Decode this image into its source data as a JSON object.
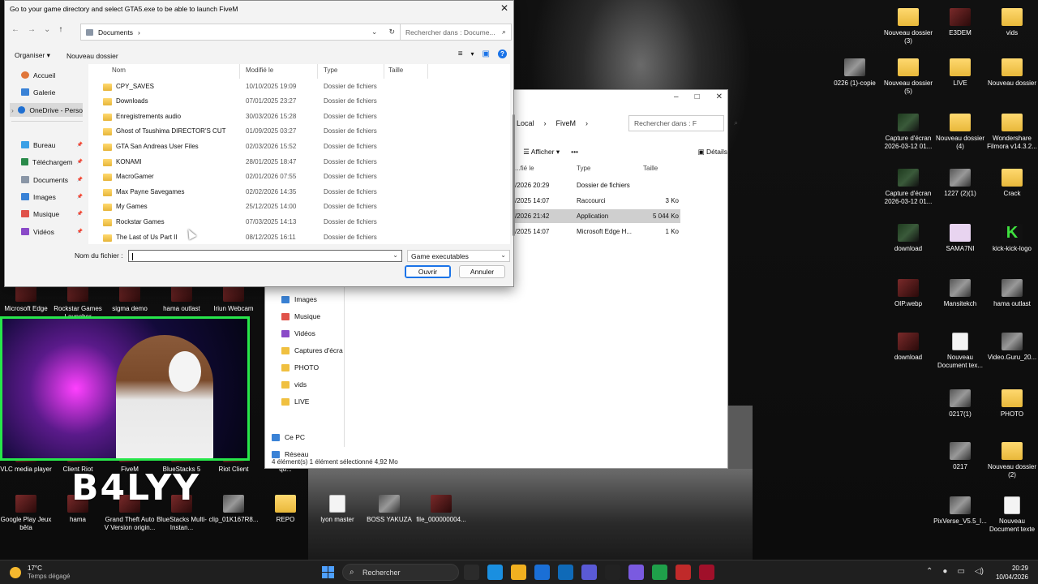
{
  "desktop": {
    "icons": [
      {
        "label": "Nouveau dossier (3)",
        "kind": "folder"
      },
      {
        "label": "E3DEM",
        "kind": "app"
      },
      {
        "label": "vids",
        "kind": "folder"
      },
      {
        "label": "0226 (1)-copie",
        "kind": "img"
      },
      {
        "label": "Nouveau dossier (5)",
        "kind": "folder"
      },
      {
        "label": "LIVE",
        "kind": "folder"
      },
      {
        "label": "Nouveau dossier",
        "kind": "folder"
      },
      {
        "label": "Capture d'écran 2026-03-12 01...",
        "kind": "dark"
      },
      {
        "label": "Nouveau dossier (4)",
        "kind": "folder"
      },
      {
        "label": "Wondershare Filmora v14.3.2...",
        "kind": "folder"
      },
      {
        "label": "Capture d'écran 2026-03-12 01...",
        "kind": "dark"
      },
      {
        "label": "1227 (2)(1)",
        "kind": "img"
      },
      {
        "label": "Crack",
        "kind": "folder"
      },
      {
        "label": "download",
        "kind": "dark"
      },
      {
        "label": "SAMA7NI",
        "kind": "pink"
      },
      {
        "label": "kick-kick-logo",
        "kind": "green"
      },
      {
        "label": "OIP.webp",
        "kind": "app"
      },
      {
        "label": "Mansitekch",
        "kind": "img"
      },
      {
        "label": "hama outlast",
        "kind": "img"
      },
      {
        "label": "download",
        "kind": "app"
      },
      {
        "label": "Nouveau Document tex...",
        "kind": "doc"
      },
      {
        "label": "Video.Guru_20...",
        "kind": "img"
      },
      {
        "label": "0217(1)",
        "kind": "img"
      },
      {
        "label": "PHOTO",
        "kind": "folder"
      },
      {
        "label": "0217",
        "kind": "img"
      },
      {
        "label": "Nouveau dossier (2)",
        "kind": "folder"
      },
      {
        "label": "PixVerse_V5.5_I...",
        "kind": "img"
      },
      {
        "label": "Nouveau Document texte",
        "kind": "doc"
      },
      {
        "label": "Microsoft Edge",
        "kind": "app"
      },
      {
        "label": "Rockstar Games Launcher",
        "kind": "app"
      },
      {
        "label": "sigma demo",
        "kind": "app"
      },
      {
        "label": "hama outlast",
        "kind": "app"
      },
      {
        "label": "Iriun Webcam",
        "kind": "app"
      },
      {
        "label": "VLC media player",
        "kind": "app"
      },
      {
        "label": "Client Riot",
        "kind": "app"
      },
      {
        "label": "FiveM",
        "kind": "app"
      },
      {
        "label": "BlueStacks 5",
        "kind": "app"
      },
      {
        "label": "Riot Client",
        "kind": "app"
      },
      {
        "label": "qu...",
        "kind": "app"
      },
      {
        "label": "Google Play Jeux bêta",
        "kind": "app"
      },
      {
        "label": "hama",
        "kind": "app"
      },
      {
        "label": "Grand Theft Auto V Version origin...",
        "kind": "app"
      },
      {
        "label": "BlueStacks Multi-Instan...",
        "kind": "app"
      },
      {
        "label": "clip_01K167R8...",
        "kind": "img"
      },
      {
        "label": "REPO",
        "kind": "folder"
      },
      {
        "label": "lyon master",
        "kind": "doc"
      },
      {
        "label": "BOSS YAKUZA",
        "kind": "img"
      },
      {
        "label": "file_000000004...",
        "kind": "app"
      }
    ],
    "overlay_text": "B4LYY"
  },
  "explorer": {
    "breadcrumb": [
      "Local",
      "FiveM"
    ],
    "search_placeholder": "Rechercher dans : F",
    "cmd": {
      "view": "Afficher",
      "more": "•••",
      "details": "Détails"
    },
    "columns": [
      "...fié le",
      "Type",
      "Taille"
    ],
    "rows": [
      {
        "date": "/2026 20:29",
        "type": "Dossier de fichiers",
        "size": ""
      },
      {
        "date": "/2025 14:07",
        "type": "Raccourci",
        "size": "3 Ko"
      },
      {
        "date": "/2026 21:42",
        "type": "Application",
        "size": "5 044 Ko"
      },
      {
        "date": "/2025 14:07",
        "type": "Microsoft Edge H...",
        "size": "1 Ko"
      }
    ],
    "nav": [
      "Images",
      "Musique",
      "Vidéos",
      "Captures d'écra",
      "PHOTO",
      "vids",
      "LIVE",
      "Ce PC",
      "Réseau"
    ],
    "status": "4 élément(s)     1 élément sélectionné  4,92 Mo"
  },
  "dialog": {
    "title": "Go to your game directory and select GTA5.exe to be able to launch FiveM",
    "address": "Documents",
    "search_placeholder": "Rechercher dans : Docume...",
    "organize": "Organiser ▾",
    "new_folder": "Nouveau dossier",
    "nav": [
      {
        "label": "Accueil",
        "color": "#e0763a",
        "pin": false
      },
      {
        "label": "Galerie",
        "color": "#3a82d6",
        "pin": false
      },
      {
        "label": "OneDrive - Perso",
        "color": "#1f6fd1",
        "pin": false,
        "selected": true
      },
      {
        "label": "Bureau",
        "color": "#3aa0e6",
        "pin": true
      },
      {
        "label": "Téléchargem",
        "color": "#2a8a4a",
        "pin": true
      },
      {
        "label": "Documents",
        "color": "#8a96a6",
        "pin": true
      },
      {
        "label": "Images",
        "color": "#3a82d6",
        "pin": true
      },
      {
        "label": "Musique",
        "color": "#e0524a",
        "pin": true
      },
      {
        "label": "Vidéos",
        "color": "#8a4ac8",
        "pin": true
      }
    ],
    "columns": {
      "name": "Nom",
      "modified": "Modifié le",
      "type": "Type",
      "size": "Taille"
    },
    "files": [
      {
        "name": "CPY_SAVES",
        "modified": "10/10/2025 19:09",
        "type": "Dossier de fichiers"
      },
      {
        "name": "Downloads",
        "modified": "07/01/2025 23:27",
        "type": "Dossier de fichiers"
      },
      {
        "name": "Enregistrements audio",
        "modified": "30/03/2026 15:28",
        "type": "Dossier de fichiers"
      },
      {
        "name": "Ghost of Tsushima DIRECTOR'S CUT",
        "modified": "01/09/2025 03:27",
        "type": "Dossier de fichiers"
      },
      {
        "name": "GTA San Andreas User Files",
        "modified": "02/03/2026 15:52",
        "type": "Dossier de fichiers"
      },
      {
        "name": "KONAMI",
        "modified": "28/01/2025 18:47",
        "type": "Dossier de fichiers"
      },
      {
        "name": "MacroGamer",
        "modified": "02/01/2026 07:55",
        "type": "Dossier de fichiers"
      },
      {
        "name": "Max Payne Savegames",
        "modified": "02/02/2026 14:35",
        "type": "Dossier de fichiers"
      },
      {
        "name": "My Games",
        "modified": "25/12/2025 14:00",
        "type": "Dossier de fichiers"
      },
      {
        "name": "Rockstar Games",
        "modified": "07/03/2025 14:13",
        "type": "Dossier de fichiers"
      },
      {
        "name": "The Last of Us Part II",
        "modified": "08/12/2025 16:11",
        "type": "Dossier de fichiers"
      }
    ],
    "filename_label": "Nom du fichier :",
    "filename_value": "",
    "filter": "Game executables",
    "open": "Ouvrir",
    "cancel": "Annuler"
  },
  "taskbar": {
    "weather_temp": "17°C",
    "weather_desc": "Temps dégagé",
    "search": "Rechercher",
    "time": "20:29",
    "date": "10/04/2026",
    "app_colors": [
      "#2b2b2b",
      "#1a8fe0",
      "#f0b020",
      "#1a6fd6",
      "#0f6ab8",
      "#5a5ad6",
      "#222222",
      "#7a5ae0",
      "#1fa04a",
      "#c02a2a",
      "#a0102a"
    ]
  }
}
